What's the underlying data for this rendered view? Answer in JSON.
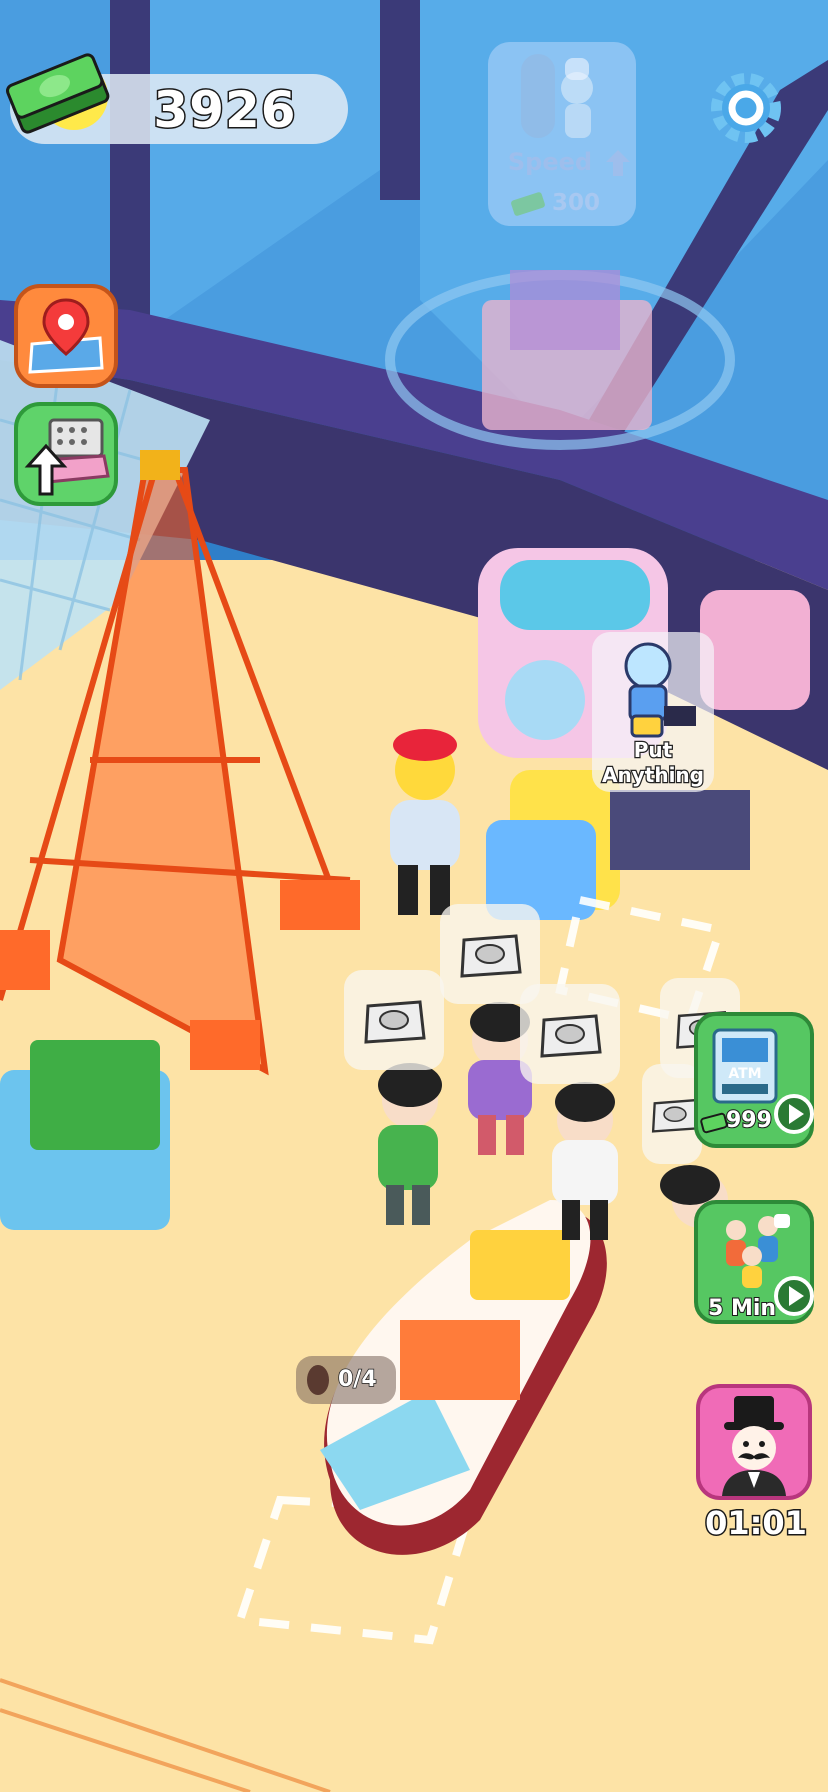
{
  "hud": {
    "money": "3926",
    "money_icon": "cash-stack-icon",
    "settings_icon": "gear-icon"
  },
  "speed_upgrade": {
    "label": "Speed",
    "cost": "300",
    "icon": "chef-icon"
  },
  "side_buttons": {
    "map_icon": "map-pin-icon",
    "upgrade_icon": "workbench-upgrade-icon"
  },
  "machine": {
    "label_line1": "Put",
    "label_line2": "Anything",
    "icon": "gacha-machine-icon"
  },
  "customers": {
    "order_icon": "oyster-plate-icon",
    "order_count": 5
  },
  "counter": {
    "progress": "0/4",
    "item_icon": "meat-icon"
  },
  "right_buttons": {
    "atm_cost": "999",
    "atm_text": "ATM",
    "boost_label": "5 Min",
    "vip_timer": "01:01"
  },
  "colors": {
    "floor": "#fde3a6",
    "water": "#3a8fd6",
    "wall": "#3b3a78",
    "eiffel": "#ff6a2a",
    "green_button": "#56c762",
    "pink_button": "#f06bb7",
    "orange_button": "#ff8a3d"
  }
}
